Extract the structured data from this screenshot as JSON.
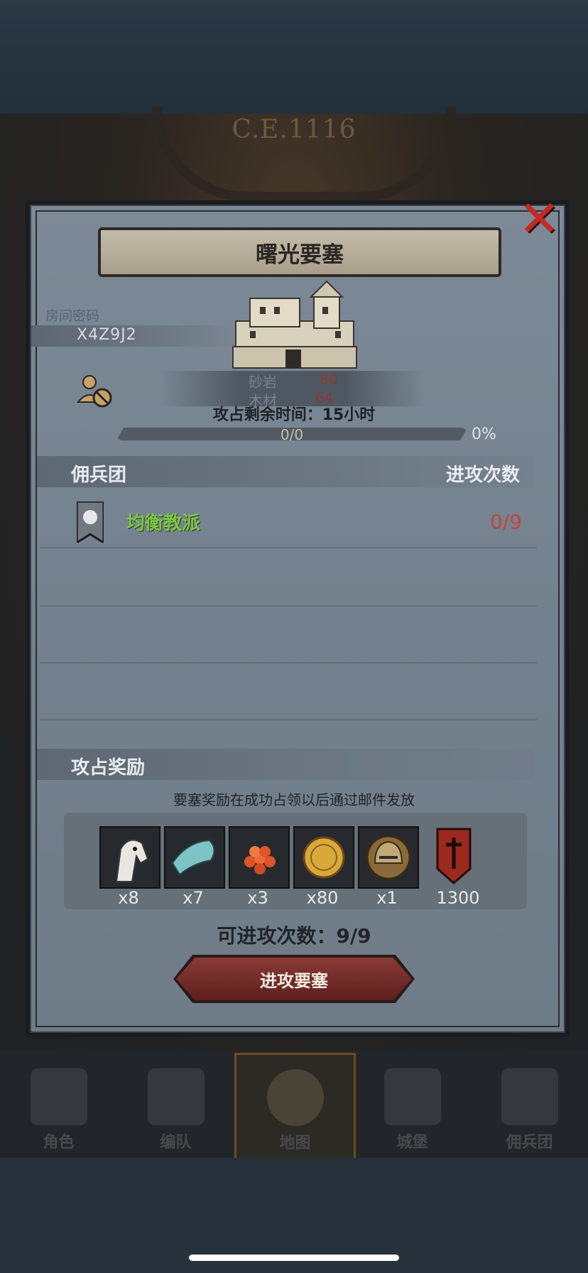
{
  "header": {
    "year": "C.E.1116"
  },
  "modal": {
    "title": "曙光要塞",
    "close_icon": "close-x-icon",
    "room": {
      "label": "房间密码",
      "code": "X4Z9J2"
    },
    "resources": [
      {
        "name": "砂岩",
        "value": "80"
      },
      {
        "name": "木材",
        "value": "64"
      }
    ],
    "timer": "攻占剩余时间：15小时",
    "progress": {
      "text": "0/0",
      "percent": "0%",
      "fill_fraction": 0
    },
    "mercenary_section": {
      "title": "佣兵团",
      "right_label": "进攻次数",
      "rows": [
        {
          "name": "均衡教派",
          "count": "0/9"
        }
      ]
    },
    "rewards": {
      "title": "攻占奖励",
      "note": "要塞奖励在成功占领以后通过邮件发放",
      "items": [
        {
          "icon": "horse-icon",
          "qty": "x8"
        },
        {
          "icon": "cloth-icon",
          "qty": "x7"
        },
        {
          "icon": "berries-icon",
          "qty": "x3"
        },
        {
          "icon": "gold-coin-icon",
          "qty": "x80"
        },
        {
          "icon": "helmet-icon",
          "qty": "x1"
        },
        {
          "icon": "guild-banner-icon",
          "qty": "1300"
        }
      ]
    },
    "attempts": "可进攻次数：9/9",
    "attack_button": "进攻要塞"
  },
  "nav": {
    "items": [
      {
        "label": "角色",
        "icon": "knight-icon"
      },
      {
        "label": "编队",
        "icon": "helmet-icon"
      },
      {
        "label": "地图",
        "icon": "map-icon",
        "active": true
      },
      {
        "label": "城堡",
        "icon": "castle-icon"
      },
      {
        "label": "佣兵团",
        "icon": "mercenary-icon"
      }
    ]
  },
  "colors": {
    "accent_red": "#c4453a",
    "merc_green": "#7cc742",
    "close_red": "#c42a22"
  }
}
